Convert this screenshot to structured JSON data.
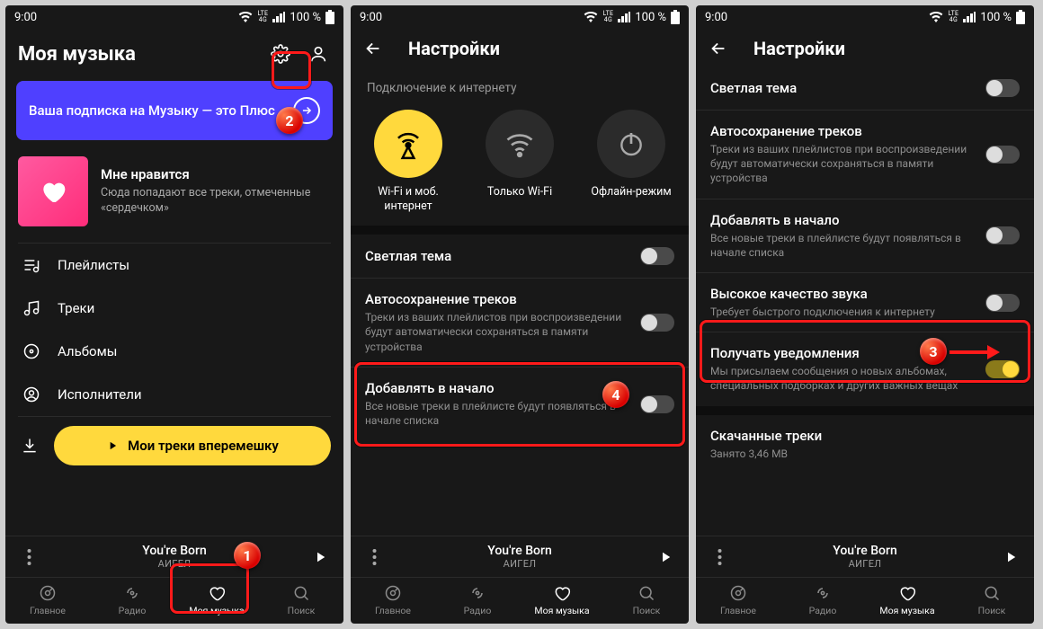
{
  "status": {
    "time": "9:00",
    "lte_top": "LTE",
    "lte_bot": "4G",
    "battery": "100 %"
  },
  "screen1": {
    "title": "Моя музыка",
    "promo": "Ваша подписка на Музыку — это Плюс",
    "liked_title": "Мне нравится",
    "liked_sub": "Сюда попадают все треки, отмеченные «сердечком»",
    "menu": {
      "playlists": "Плейлисты",
      "tracks": "Треки",
      "albums": "Альбомы",
      "artists": "Исполнители"
    },
    "shuffle": "Мои треки вперемешку"
  },
  "screen2": {
    "title": "Настройки",
    "section_net": "Подключение к интернету",
    "net": {
      "wifi_mob": "Wi-Fi и моб. интернет",
      "wifi": "Только Wi-Fi",
      "offline": "Офлайн-режим"
    },
    "rows": {
      "light_theme": "Светлая тема",
      "autosave_t": "Автосохранение треков",
      "autosave_s": "Треки из ваших плейлистов при воспроизведении будут автоматически сохраняться в памяти устройства",
      "addtop_t": "Добавлять в начало",
      "addtop_s": "Все новые треки в плейлисте будут появляться в начале списка"
    }
  },
  "screen3": {
    "title": "Настройки",
    "rows": {
      "light_theme": "Светлая тема",
      "autosave_t": "Автосохранение треков",
      "autosave_s": "Треки из ваших плейлистов при воспроизведении будут автоматически сохраняться в памяти устройства",
      "addtop_t": "Добавлять в начало",
      "addtop_s": "Все новые треки в плейлисте будут появляться в начале списка",
      "hq_t": "Высокое качество звука",
      "hq_s": "Требует быстрого подключения к интернету",
      "notif_t": "Получать уведомления",
      "notif_s": "Мы присылаем сообщения о новых альбомах, специальных подборках и других важных вещах",
      "downloaded_t": "Скачанные треки",
      "downloaded_s": "Занято 3,46 MB"
    }
  },
  "player": {
    "title": "You're Born",
    "artist": "АИГЕЛ"
  },
  "tabs": {
    "home": "Главное",
    "radio": "Радио",
    "mymusic": "Моя музыка",
    "search": "Поиск"
  },
  "callouts": {
    "b1": "1",
    "b2": "2",
    "b3": "3",
    "b4": "4"
  }
}
